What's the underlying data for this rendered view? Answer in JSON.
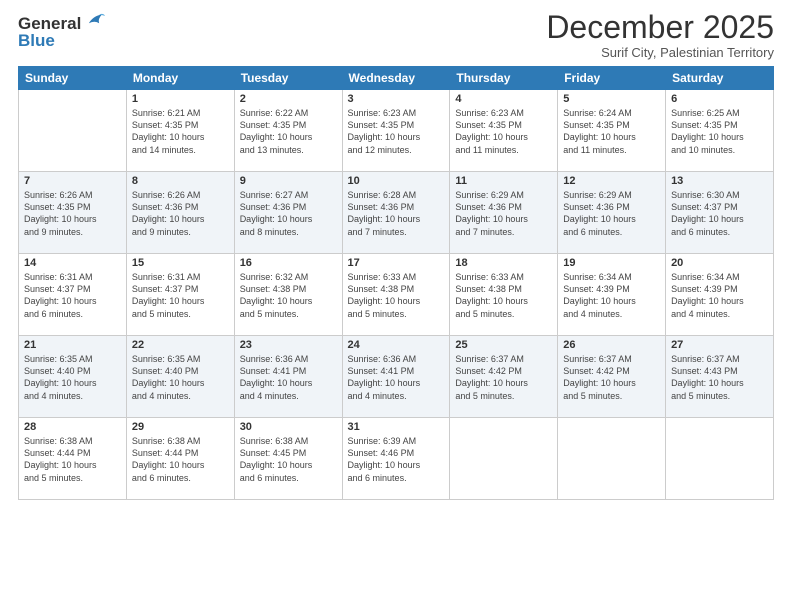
{
  "logo": {
    "general": "General",
    "blue": "Blue"
  },
  "title": "December 2025",
  "subtitle": "Surif City, Palestinian Territory",
  "days_of_week": [
    "Sunday",
    "Monday",
    "Tuesday",
    "Wednesday",
    "Thursday",
    "Friday",
    "Saturday"
  ],
  "weeks": [
    [
      {
        "day": "",
        "info": ""
      },
      {
        "day": "1",
        "info": "Sunrise: 6:21 AM\nSunset: 4:35 PM\nDaylight: 10 hours\nand 14 minutes."
      },
      {
        "day": "2",
        "info": "Sunrise: 6:22 AM\nSunset: 4:35 PM\nDaylight: 10 hours\nand 13 minutes."
      },
      {
        "day": "3",
        "info": "Sunrise: 6:23 AM\nSunset: 4:35 PM\nDaylight: 10 hours\nand 12 minutes."
      },
      {
        "day": "4",
        "info": "Sunrise: 6:23 AM\nSunset: 4:35 PM\nDaylight: 10 hours\nand 11 minutes."
      },
      {
        "day": "5",
        "info": "Sunrise: 6:24 AM\nSunset: 4:35 PM\nDaylight: 10 hours\nand 11 minutes."
      },
      {
        "day": "6",
        "info": "Sunrise: 6:25 AM\nSunset: 4:35 PM\nDaylight: 10 hours\nand 10 minutes."
      }
    ],
    [
      {
        "day": "7",
        "info": "Sunrise: 6:26 AM\nSunset: 4:35 PM\nDaylight: 10 hours\nand 9 minutes."
      },
      {
        "day": "8",
        "info": "Sunrise: 6:26 AM\nSunset: 4:36 PM\nDaylight: 10 hours\nand 9 minutes."
      },
      {
        "day": "9",
        "info": "Sunrise: 6:27 AM\nSunset: 4:36 PM\nDaylight: 10 hours\nand 8 minutes."
      },
      {
        "day": "10",
        "info": "Sunrise: 6:28 AM\nSunset: 4:36 PM\nDaylight: 10 hours\nand 7 minutes."
      },
      {
        "day": "11",
        "info": "Sunrise: 6:29 AM\nSunset: 4:36 PM\nDaylight: 10 hours\nand 7 minutes."
      },
      {
        "day": "12",
        "info": "Sunrise: 6:29 AM\nSunset: 4:36 PM\nDaylight: 10 hours\nand 6 minutes."
      },
      {
        "day": "13",
        "info": "Sunrise: 6:30 AM\nSunset: 4:37 PM\nDaylight: 10 hours\nand 6 minutes."
      }
    ],
    [
      {
        "day": "14",
        "info": "Sunrise: 6:31 AM\nSunset: 4:37 PM\nDaylight: 10 hours\nand 6 minutes."
      },
      {
        "day": "15",
        "info": "Sunrise: 6:31 AM\nSunset: 4:37 PM\nDaylight: 10 hours\nand 5 minutes."
      },
      {
        "day": "16",
        "info": "Sunrise: 6:32 AM\nSunset: 4:38 PM\nDaylight: 10 hours\nand 5 minutes."
      },
      {
        "day": "17",
        "info": "Sunrise: 6:33 AM\nSunset: 4:38 PM\nDaylight: 10 hours\nand 5 minutes."
      },
      {
        "day": "18",
        "info": "Sunrise: 6:33 AM\nSunset: 4:38 PM\nDaylight: 10 hours\nand 5 minutes."
      },
      {
        "day": "19",
        "info": "Sunrise: 6:34 AM\nSunset: 4:39 PM\nDaylight: 10 hours\nand 4 minutes."
      },
      {
        "day": "20",
        "info": "Sunrise: 6:34 AM\nSunset: 4:39 PM\nDaylight: 10 hours\nand 4 minutes."
      }
    ],
    [
      {
        "day": "21",
        "info": "Sunrise: 6:35 AM\nSunset: 4:40 PM\nDaylight: 10 hours\nand 4 minutes."
      },
      {
        "day": "22",
        "info": "Sunrise: 6:35 AM\nSunset: 4:40 PM\nDaylight: 10 hours\nand 4 minutes."
      },
      {
        "day": "23",
        "info": "Sunrise: 6:36 AM\nSunset: 4:41 PM\nDaylight: 10 hours\nand 4 minutes."
      },
      {
        "day": "24",
        "info": "Sunrise: 6:36 AM\nSunset: 4:41 PM\nDaylight: 10 hours\nand 4 minutes."
      },
      {
        "day": "25",
        "info": "Sunrise: 6:37 AM\nSunset: 4:42 PM\nDaylight: 10 hours\nand 5 minutes."
      },
      {
        "day": "26",
        "info": "Sunrise: 6:37 AM\nSunset: 4:42 PM\nDaylight: 10 hours\nand 5 minutes."
      },
      {
        "day": "27",
        "info": "Sunrise: 6:37 AM\nSunset: 4:43 PM\nDaylight: 10 hours\nand 5 minutes."
      }
    ],
    [
      {
        "day": "28",
        "info": "Sunrise: 6:38 AM\nSunset: 4:44 PM\nDaylight: 10 hours\nand 5 minutes."
      },
      {
        "day": "29",
        "info": "Sunrise: 6:38 AM\nSunset: 4:44 PM\nDaylight: 10 hours\nand 6 minutes."
      },
      {
        "day": "30",
        "info": "Sunrise: 6:38 AM\nSunset: 4:45 PM\nDaylight: 10 hours\nand 6 minutes."
      },
      {
        "day": "31",
        "info": "Sunrise: 6:39 AM\nSunset: 4:46 PM\nDaylight: 10 hours\nand 6 minutes."
      },
      {
        "day": "",
        "info": ""
      },
      {
        "day": "",
        "info": ""
      },
      {
        "day": "",
        "info": ""
      }
    ]
  ]
}
